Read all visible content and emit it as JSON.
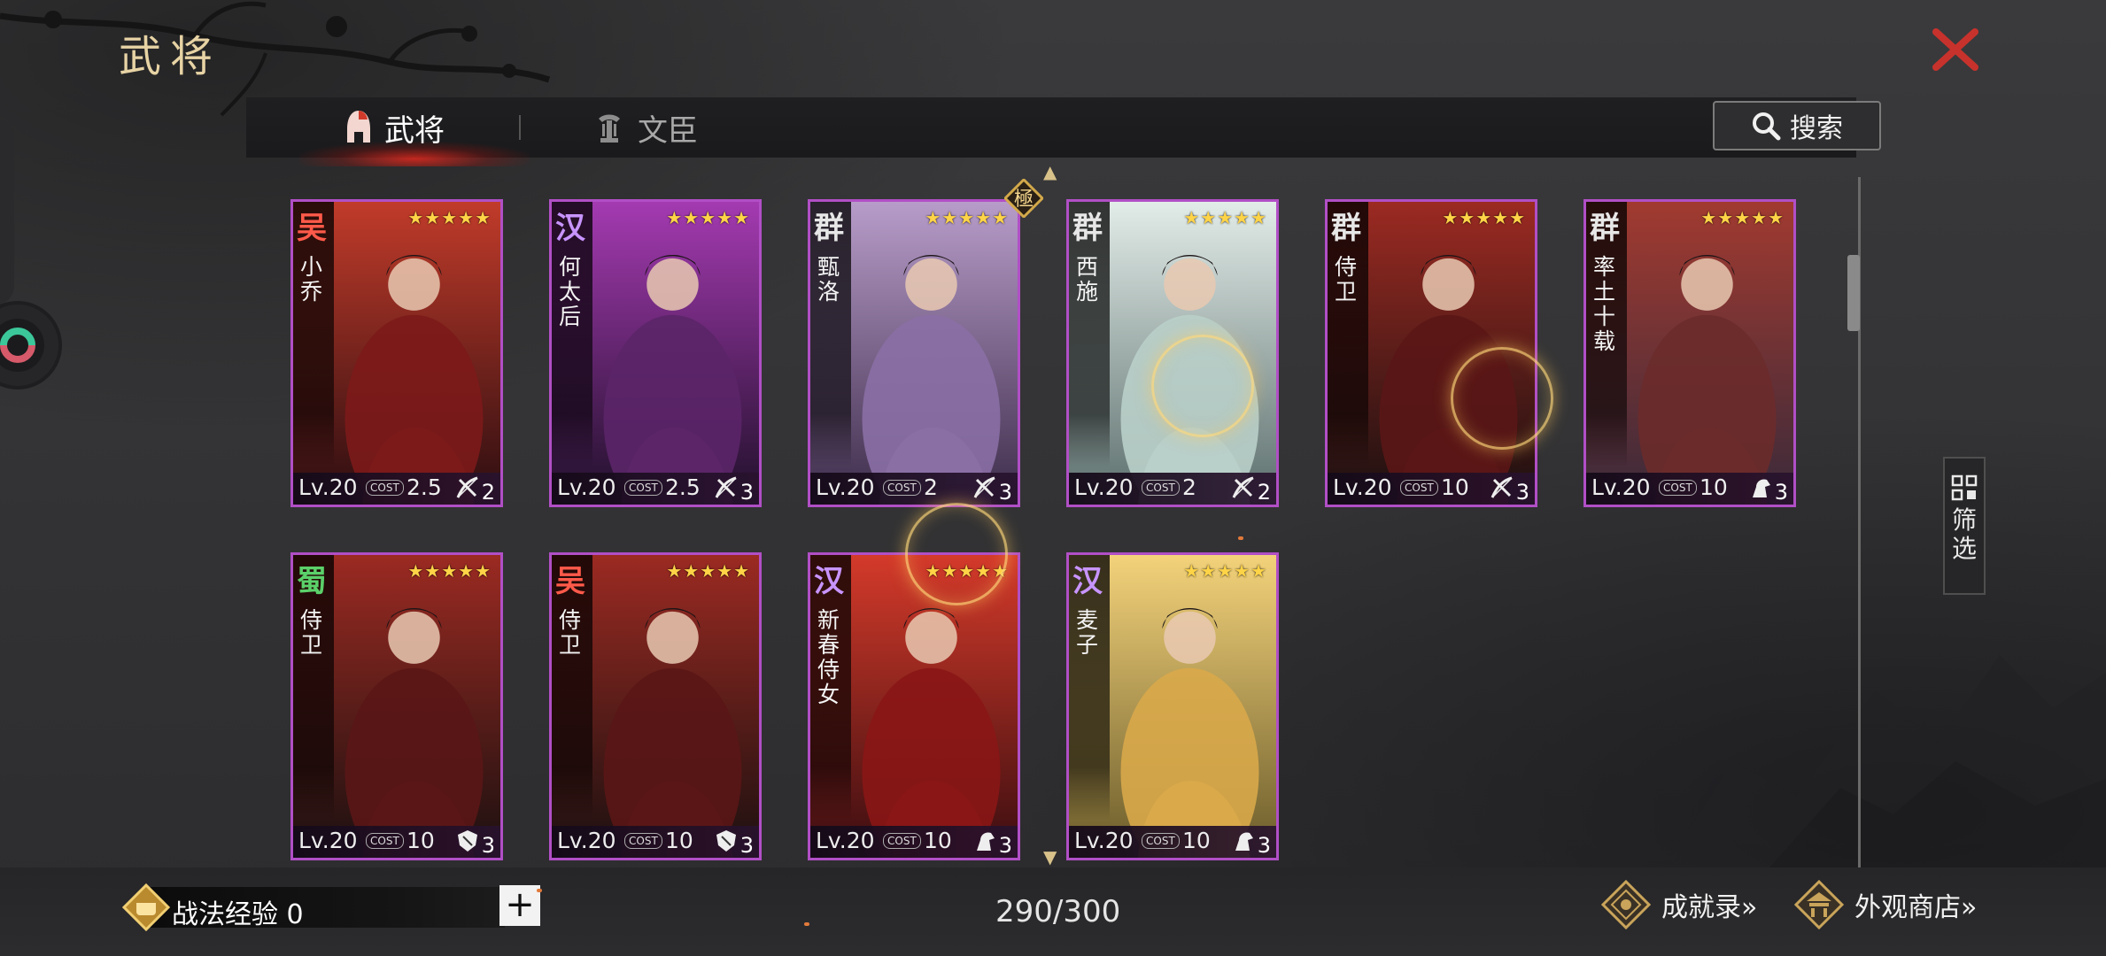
{
  "page": {
    "title": "武将"
  },
  "tabs": [
    {
      "label": "武将",
      "active": true,
      "icon": "helmet-icon"
    },
    {
      "label": "文臣",
      "active": false,
      "icon": "incense-icon"
    }
  ],
  "search": {
    "label": "搜索",
    "icon": "search-icon"
  },
  "filter": {
    "label": "筛选",
    "icon": "grid-icon"
  },
  "cards": [
    {
      "faction": "吴",
      "faction_color": "#ff5a4a",
      "name": "小乔",
      "stars": "★★★★★",
      "lv": "Lv.20",
      "cost_label": "COST",
      "cost": "2.5",
      "type_icon": "bow-icon",
      "type_count": "2",
      "palette": [
        "#7c1a1a",
        "#c13b2a",
        "#2b0d10"
      ]
    },
    {
      "faction": "汉",
      "faction_color": "#c894ff",
      "name": "何太后",
      "stars": "★★★★★",
      "lv": "Lv.20",
      "cost_label": "COST",
      "cost": "2.5",
      "type_icon": "bow-icon",
      "type_count": "3",
      "palette": [
        "#5b2568",
        "#a43ab1",
        "#20102a"
      ]
    },
    {
      "faction": "群",
      "faction_color": "#e7e7e7",
      "name": "甄洛",
      "stars": "★★★★★",
      "lv": "Lv.20",
      "cost_label": "COST",
      "cost": "2",
      "type_icon": "bow-icon",
      "type_count": "3",
      "palette": [
        "#8a6fa5",
        "#b79cc9",
        "#3d2c4a"
      ],
      "badge": "極"
    },
    {
      "faction": "群",
      "faction_color": "#e7e7e7",
      "name": "西施",
      "stars": "★★★★★",
      "lv": "Lv.20",
      "cost_label": "COST",
      "cost": "2",
      "type_icon": "bow-icon",
      "type_count": "2",
      "palette": [
        "#b9cfc9",
        "#e2ece8",
        "#5c6f6d"
      ]
    },
    {
      "faction": "群",
      "faction_color": "#e7e7e7",
      "name": "侍卫",
      "stars": "★★★★★",
      "lv": "Lv.20",
      "cost_label": "COST",
      "cost": "10",
      "type_icon": "bow-icon",
      "type_count": "3",
      "palette": [
        "#5a1616",
        "#9b2a22",
        "#1a1010"
      ]
    },
    {
      "faction": "群",
      "faction_color": "#e7e7e7",
      "name": "率土十载",
      "stars": "★★★★★",
      "lv": "Lv.20",
      "cost_label": "COST",
      "cost": "10",
      "type_icon": "horse-icon",
      "type_count": "3",
      "palette": [
        "#6b2b2b",
        "#a13a30",
        "#3a2a3a"
      ]
    },
    {
      "faction": "蜀",
      "faction_color": "#5bd06a",
      "name": "侍卫",
      "stars": "★★★★★",
      "lv": "Lv.20",
      "cost_label": "COST",
      "cost": "10",
      "type_icon": "shield-icon",
      "type_count": "3",
      "palette": [
        "#5a1616",
        "#9b2a22",
        "#1a1010"
      ]
    },
    {
      "faction": "吴",
      "faction_color": "#ff5a4a",
      "name": "侍卫",
      "stars": "★★★★★",
      "lv": "Lv.20",
      "cost_label": "COST",
      "cost": "10",
      "type_icon": "shield-icon",
      "type_count": "3",
      "palette": [
        "#5a1616",
        "#9b2a22",
        "#1a1010"
      ]
    },
    {
      "faction": "汉",
      "faction_color": "#c894ff",
      "name": "新春侍女",
      "stars": "★★★★★",
      "lv": "Lv.20",
      "cost_label": "COST",
      "cost": "10",
      "type_icon": "horse-icon",
      "type_count": "3",
      "palette": [
        "#8a1616",
        "#d43a2a",
        "#3a0d10"
      ]
    },
    {
      "faction": "汉",
      "faction_color": "#c894ff",
      "name": "麦子",
      "stars": "★★★★★",
      "lv": "Lv.20",
      "cost_label": "COST",
      "cost": "10",
      "type_icon": "horse-icon",
      "type_count": "3",
      "palette": [
        "#d9a94a",
        "#f3d27a",
        "#6a5b2a"
      ]
    }
  ],
  "footer": {
    "exp_label": "战法经验 0",
    "plus": "+",
    "count": "290/300",
    "achievements": "成就录»",
    "shop": "外观商店»"
  },
  "colors": {
    "accent_gold": "#e7d3a4",
    "card_border": "#b14fc6",
    "close_red": "#c8322c"
  }
}
